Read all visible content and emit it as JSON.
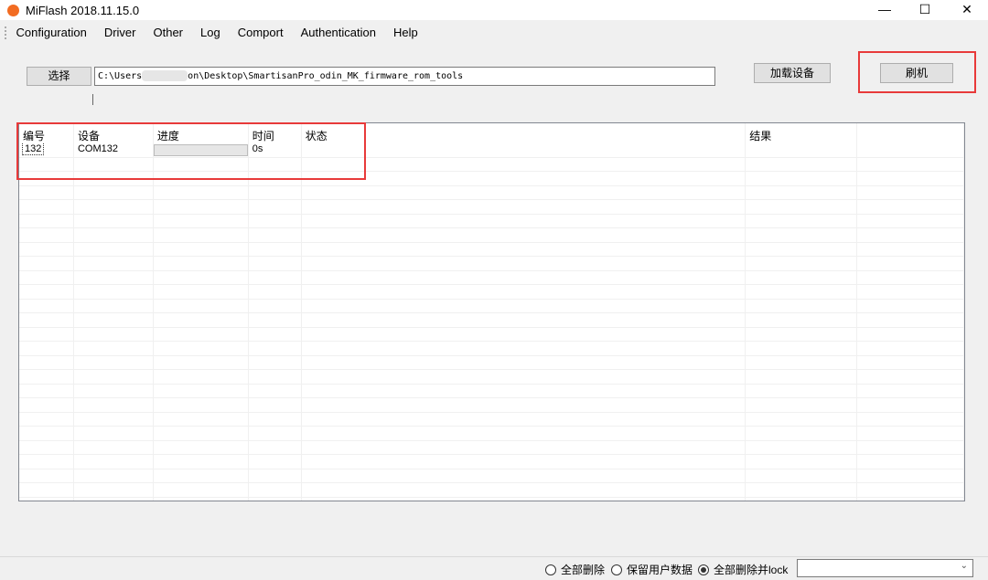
{
  "window": {
    "title": "MiFlash 2018.11.15.0",
    "logo_text": "mi"
  },
  "menu": [
    "Configuration",
    "Driver",
    "Other",
    "Log",
    "Comport",
    "Authentication",
    "Help"
  ],
  "toolbar": {
    "select_label": "选择",
    "path_prefix": "C:\\Users",
    "path_suffix": "on\\Desktop\\SmartisanPro_odin_MK_firmware_rom_tools",
    "load_device_label": "加载设备",
    "flash_label": "刷机"
  },
  "table": {
    "headers": [
      "编号",
      "设备",
      "进度",
      "时间",
      "状态",
      "结果",
      ""
    ],
    "rows": [
      {
        "id": "132",
        "device": "COM132",
        "progress": 0,
        "time": "0s",
        "status": "",
        "result": ""
      }
    ]
  },
  "bottom": {
    "options": [
      {
        "label": "全部删除",
        "selected": false
      },
      {
        "label": "保留用户数据",
        "selected": false
      },
      {
        "label": "全部删除并lock",
        "selected": true
      }
    ],
    "dropdown_value": ""
  },
  "colors": {
    "highlight": "#e83a3a",
    "logo": "#f26c22"
  }
}
